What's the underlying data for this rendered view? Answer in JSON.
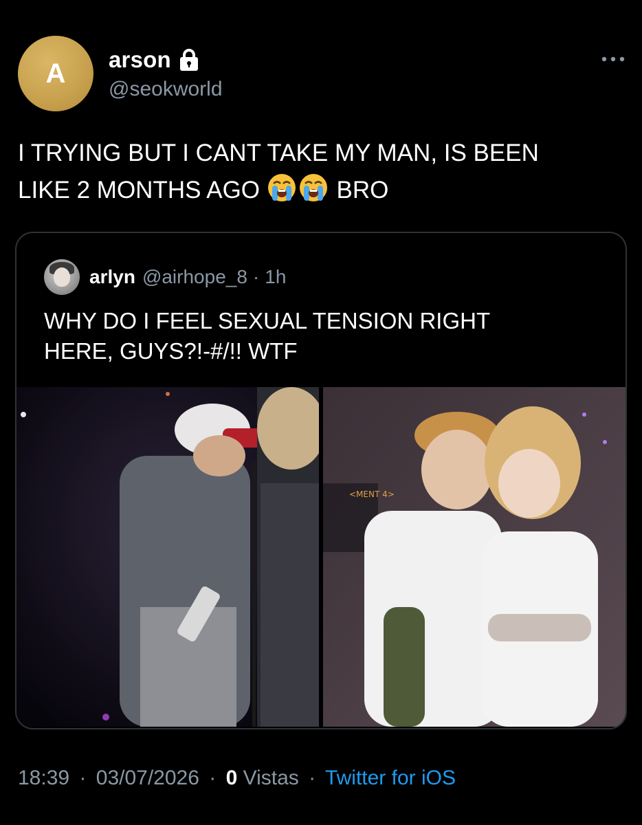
{
  "tweet": {
    "avatar_letter": "A",
    "display_name": "arson",
    "handle": "@seokworld",
    "text_line1": "I TRYING BUT I CANT TAKE MY MAN, IS BEEN",
    "text_line2_a": "LIKE 2 MONTHS AGO",
    "text_line2_b": "BRO",
    "emojis": [
      "loudly-crying-face",
      "loudly-crying-face"
    ]
  },
  "quote": {
    "display_name": "arlyn",
    "handle": "@airhope_8",
    "separator": "·",
    "time": "1h",
    "text_line1": "WHY DO I FEEL SEXUAL TENSION RIGHT",
    "text_line2": "HERE, GUYS?!-#/!! WTF",
    "media_left_overlay": [],
    "media_right_overlay": "<MENT 4>"
  },
  "footer": {
    "time": "18:39",
    "dot1": "·",
    "date": "03/07/2026",
    "dot2": "·",
    "views_count": "0",
    "views_label": "Vistas",
    "dot3": "·",
    "client": "Twitter for iOS"
  },
  "colors": {
    "background": "#000000",
    "text": "#ffffff",
    "secondary": "#8b98a5",
    "accent": "#1d9bf0",
    "avatar": "#c9a24f",
    "border": "#2f3336"
  },
  "icons": {
    "lock": "lock-icon",
    "more": "more-horizontal-icon"
  }
}
